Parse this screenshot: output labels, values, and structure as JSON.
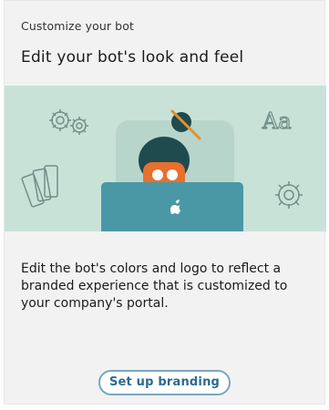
{
  "card": {
    "eyebrow": "Customize your bot",
    "title": "Edit your bot's look and feel",
    "description": "Edit the bot's colors and logo to reflect a branded experience that is customized to your company's portal.",
    "cta_label": "Set up branding",
    "illustration_text": "Aa"
  },
  "colors": {
    "illustration_bg": "#c9e2d8",
    "laptop": "#4a98a6",
    "hair": "#1f4b4f",
    "cta_text": "#2d6a8f",
    "cta_border": "#7aa6c0"
  },
  "icons": [
    "gear-icon",
    "gear-icon",
    "swatch-cards-icon",
    "font-aa-icon",
    "apple-logo-icon"
  ]
}
